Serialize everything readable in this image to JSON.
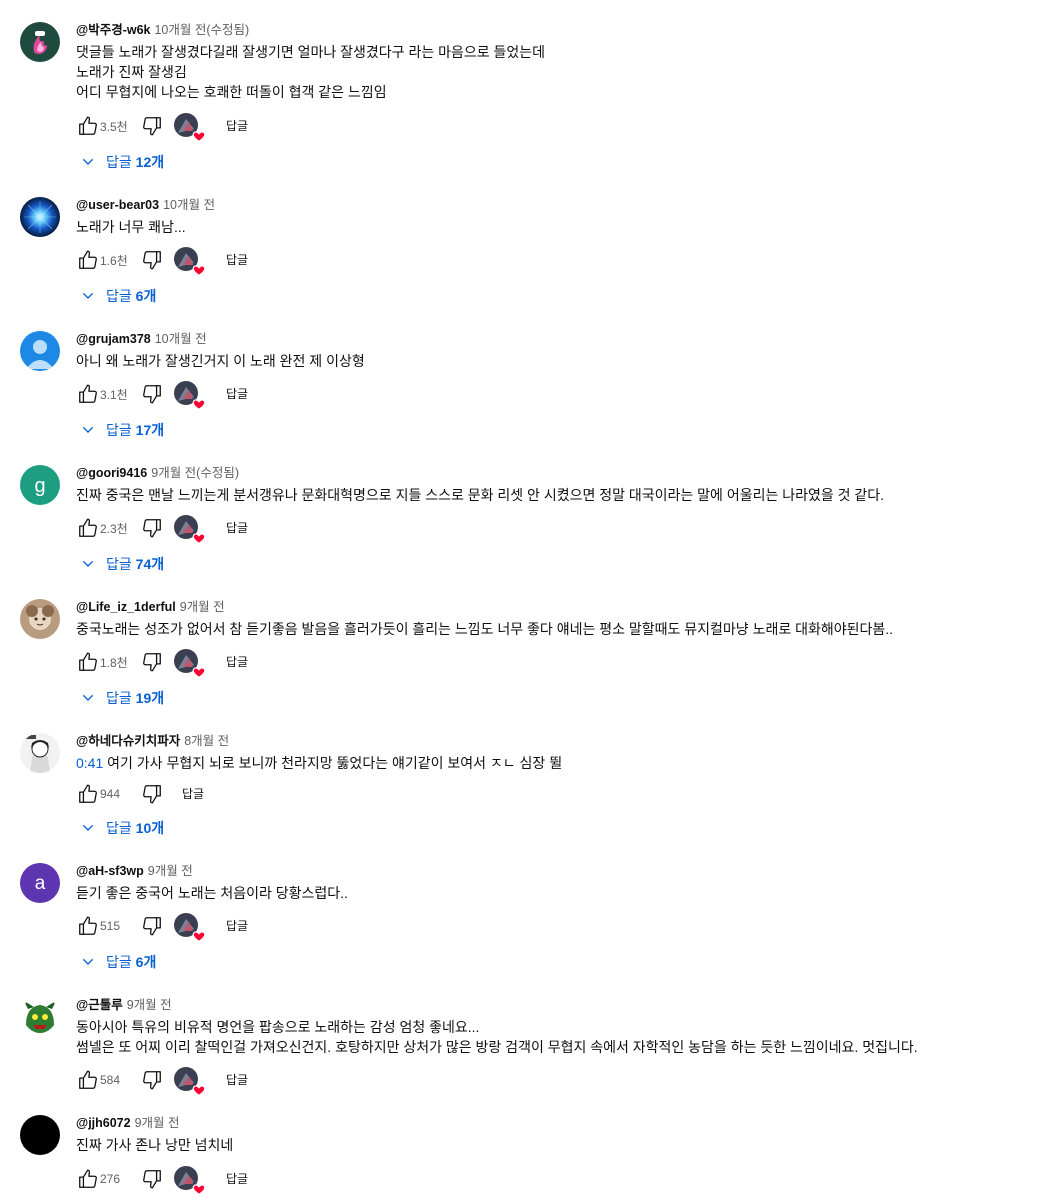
{
  "ui": {
    "reply_label": "답글",
    "replies_prefix": "답글",
    "accent_color": "#065fd4",
    "heart_color": "#ff0033",
    "icons": [
      "like-icon",
      "dislike-icon",
      "heart-icon",
      "chevron-down-icon"
    ]
  },
  "comments": [
    {
      "author": "@박주경-w6k",
      "time": "10개월 전(수정됨)",
      "lines": [
        "댓글들 노래가 잘생겼다길래 잘생기면 얼마나 잘생겼다구 라는 마음으로 들었는데",
        "노래가 진짜 잘생김",
        "어디 무협지에 나오는 호쾌한 떠돌이 협객 같은 느낌임"
      ],
      "likes": "3.5천",
      "replies_count": "12개"
    },
    {
      "author": "@user-bear03",
      "time": "10개월 전",
      "lines": [
        "노래가 너무 쾌남..."
      ],
      "likes": "1.6천",
      "replies_count": "6개"
    },
    {
      "author": "@grujam378",
      "time": "10개월 전",
      "lines": [
        "아니 왜 노래가 잘생긴거지 이 노래 완전 제 이상형"
      ],
      "likes": "3.1천",
      "replies_count": "17개"
    },
    {
      "author": "@goori9416",
      "time": "9개월 전(수정됨)",
      "lines": [
        "진짜 중국은 맨날 느끼는게 분서갱유나 문화대혁명으로 지들 스스로 문화 리셋 안 시켰으면 정말 대국이라는 말에 어울리는 나라였을 것 같다."
      ],
      "likes": "2.3천",
      "replies_count": "74개"
    },
    {
      "author": "@Life_iz_1derful",
      "time": "9개월 전",
      "lines": [
        "중국노래는 성조가 없어서 참 듣기좋음 발음을 흘러가듯이 흘리는 느낌도 너무 좋다 얘네는 평소 말할때도 뮤지컬마냥 노래로 대화해야된다봄.."
      ],
      "likes": "1.8천",
      "replies_count": "19개"
    },
    {
      "author": "@하네다슈키치파자",
      "time": "8개월 전",
      "timestamp": "0:41",
      "lines": [
        " 여기 가사 무협지 뇌로 보니까 천라지망 뚫었다는 얘기같이 보여서 ㅈㄴ 심장 뛸"
      ],
      "likes": "944",
      "replies_count": "10개"
    },
    {
      "author": "@aH-sf3wp",
      "time": "9개월 전",
      "lines": [
        "듣기 좋은 중국어 노래는 처음이라 당황스럽다.."
      ],
      "likes": "515",
      "replies_count": "6개"
    },
    {
      "author": "@근툴루",
      "time": "9개월 전",
      "lines": [
        "동아시아 특유의 비유적 명언을 팝송으로 노래하는 감성 엄청 좋네요...",
        "썸넬은 또 어찌 이리 찰떡인걸 가져오신건지. 호탕하지만 상처가 많은 방랑 검객이 무협지 속에서 자학적인 농담을 하는 듯한 느낌이네요. 멋집니다."
      ],
      "likes": "584"
    },
    {
      "author": "@jjh6072",
      "time": "9개월 전",
      "lines": [
        "진짜 가사 존나 낭만 넘치네"
      ],
      "likes": "276"
    }
  ]
}
